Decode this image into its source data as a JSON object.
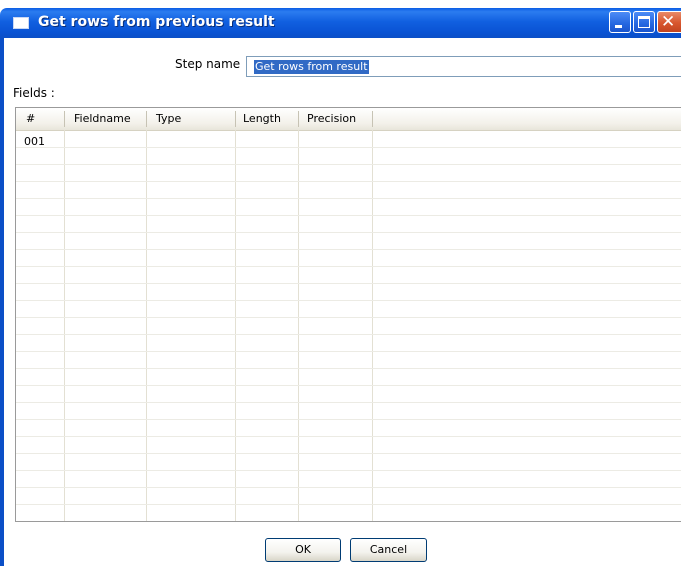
{
  "window": {
    "title": "Get rows from previous result",
    "title_icon": "window-icon",
    "controls": [
      "minimize-icon",
      "maximize-icon",
      "close-icon"
    ],
    "accent_color": "#0b4fc7"
  },
  "step": {
    "label": "Step name",
    "value": "Get rows from result"
  },
  "fields": {
    "label": "Fields :",
    "columns": [
      "#",
      "Fieldname",
      "Type",
      "Length",
      "Precision"
    ],
    "rows": [
      {
        "num": "001",
        "fieldname": "",
        "type": "",
        "length": "",
        "precision": ""
      }
    ]
  },
  "buttons": {
    "ok": "OK",
    "cancel": "Cancel"
  }
}
